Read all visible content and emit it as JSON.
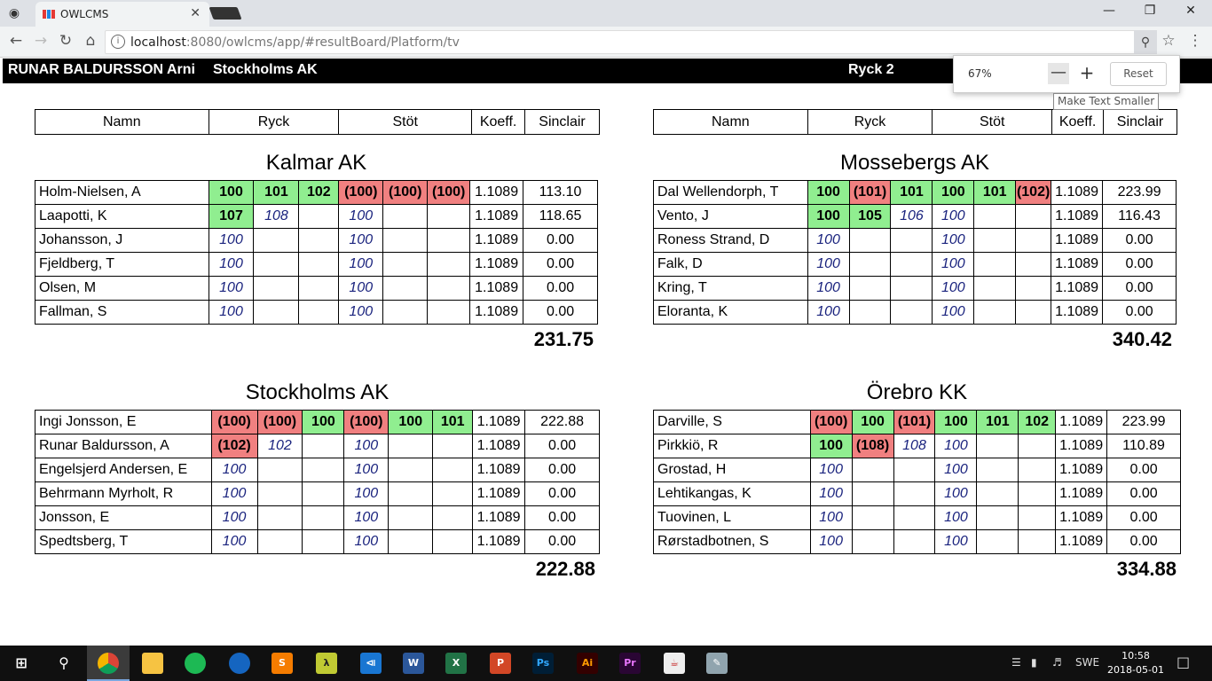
{
  "browser": {
    "tab_title": "OWLCMS",
    "url_host": "localhost",
    "url_rest": ":8080/owlcms/app/#resultBoard/Platform/tv",
    "zoom_percent": "67%",
    "zoom_reset_label": "Reset",
    "tooltip": "Make Text Smaller"
  },
  "header": {
    "athlete": "RUNAR BALDURSSON Arni",
    "team": "Stockholms AK",
    "lift": "Ryck 2"
  },
  "columns": {
    "name": "Namn",
    "snatch": "Ryck",
    "cj": "Stöt",
    "koeff": "Koeff.",
    "sinclair": "Sinclair"
  },
  "colors": {
    "good_lift": "#90ee90",
    "bad_lift": "#f08080",
    "requested": "#1a237e"
  },
  "teams": [
    {
      "name": "Kalmar AK",
      "total": "231.75",
      "athletes": [
        {
          "name": "Holm-Nielsen, A",
          "lifts": [
            [
              "100",
              "good"
            ],
            [
              "101",
              "good"
            ],
            [
              "102",
              "good"
            ],
            [
              "(100)",
              "bad"
            ],
            [
              "(100)",
              "bad"
            ],
            [
              "(100)",
              "bad"
            ]
          ],
          "koeff": "1.1089",
          "sinclair": "113.10"
        },
        {
          "name": "Laapotti, K",
          "lifts": [
            [
              "107",
              "good"
            ],
            [
              "108",
              "req"
            ],
            [
              "",
              ""
            ],
            [
              "100",
              "req"
            ],
            [
              "",
              ""
            ],
            [
              "",
              ""
            ]
          ],
          "koeff": "1.1089",
          "sinclair": "118.65"
        },
        {
          "name": "Johansson, J",
          "lifts": [
            [
              "100",
              "req"
            ],
            [
              "",
              ""
            ],
            [
              "",
              ""
            ],
            [
              "100",
              "req"
            ],
            [
              "",
              ""
            ],
            [
              "",
              ""
            ]
          ],
          "koeff": "1.1089",
          "sinclair": "0.00"
        },
        {
          "name": "Fjeldberg, T",
          "lifts": [
            [
              "100",
              "req"
            ],
            [
              "",
              ""
            ],
            [
              "",
              ""
            ],
            [
              "100",
              "req"
            ],
            [
              "",
              ""
            ],
            [
              "",
              ""
            ]
          ],
          "koeff": "1.1089",
          "sinclair": "0.00"
        },
        {
          "name": "Olsen, M",
          "lifts": [
            [
              "100",
              "req"
            ],
            [
              "",
              ""
            ],
            [
              "",
              ""
            ],
            [
              "100",
              "req"
            ],
            [
              "",
              ""
            ],
            [
              "",
              ""
            ]
          ],
          "koeff": "1.1089",
          "sinclair": "0.00"
        },
        {
          "name": "Fallman, S",
          "lifts": [
            [
              "100",
              "req"
            ],
            [
              "",
              ""
            ],
            [
              "",
              ""
            ],
            [
              "100",
              "req"
            ],
            [
              "",
              ""
            ],
            [
              "",
              ""
            ]
          ],
          "koeff": "1.1089",
          "sinclair": "0.00"
        }
      ]
    },
    {
      "name": "Mossebergs AK",
      "total": "340.42",
      "athletes": [
        {
          "name": "Dal Wellendorph, T",
          "lifts": [
            [
              "100",
              "good"
            ],
            [
              "(101)",
              "bad"
            ],
            [
              "101",
              "good"
            ],
            [
              "100",
              "good"
            ],
            [
              "101",
              "good"
            ],
            [
              "(102)",
              "bad"
            ]
          ],
          "koeff": "1.1089",
          "sinclair": "223.99"
        },
        {
          "name": "Vento, J",
          "lifts": [
            [
              "100",
              "good"
            ],
            [
              "105",
              "good"
            ],
            [
              "106",
              "req"
            ],
            [
              "100",
              "req"
            ],
            [
              "",
              ""
            ],
            [
              "",
              ""
            ]
          ],
          "koeff": "1.1089",
          "sinclair": "116.43"
        },
        {
          "name": "Roness Strand, D",
          "lifts": [
            [
              "100",
              "req"
            ],
            [
              "",
              ""
            ],
            [
              "",
              ""
            ],
            [
              "100",
              "req"
            ],
            [
              "",
              ""
            ],
            [
              "",
              ""
            ]
          ],
          "koeff": "1.1089",
          "sinclair": "0.00"
        },
        {
          "name": "Falk, D",
          "lifts": [
            [
              "100",
              "req"
            ],
            [
              "",
              ""
            ],
            [
              "",
              ""
            ],
            [
              "100",
              "req"
            ],
            [
              "",
              ""
            ],
            [
              "",
              ""
            ]
          ],
          "koeff": "1.1089",
          "sinclair": "0.00"
        },
        {
          "name": "Kring, T",
          "lifts": [
            [
              "100",
              "req"
            ],
            [
              "",
              ""
            ],
            [
              "",
              ""
            ],
            [
              "100",
              "req"
            ],
            [
              "",
              ""
            ],
            [
              "",
              ""
            ]
          ],
          "koeff": "1.1089",
          "sinclair": "0.00"
        },
        {
          "name": "Eloranta, K",
          "lifts": [
            [
              "100",
              "req"
            ],
            [
              "",
              ""
            ],
            [
              "",
              ""
            ],
            [
              "100",
              "req"
            ],
            [
              "",
              ""
            ],
            [
              "",
              ""
            ]
          ],
          "koeff": "1.1089",
          "sinclair": "0.00"
        }
      ]
    },
    {
      "name": "Stockholms AK",
      "total": "222.88",
      "athletes": [
        {
          "name": "Ingi Jonsson, E",
          "lifts": [
            [
              "(100)",
              "bad"
            ],
            [
              "(100)",
              "bad"
            ],
            [
              "100",
              "good"
            ],
            [
              "(100)",
              "bad"
            ],
            [
              "100",
              "good"
            ],
            [
              "101",
              "good"
            ]
          ],
          "koeff": "1.1089",
          "sinclair": "222.88"
        },
        {
          "name": "Runar Baldursson, A",
          "lifts": [
            [
              "(102)",
              "bad"
            ],
            [
              "102",
              "req"
            ],
            [
              "",
              ""
            ],
            [
              "100",
              "req"
            ],
            [
              "",
              ""
            ],
            [
              "",
              ""
            ]
          ],
          "koeff": "1.1089",
          "sinclair": "0.00"
        },
        {
          "name": "Engelsjerd Andersen, E",
          "lifts": [
            [
              "100",
              "req"
            ],
            [
              "",
              ""
            ],
            [
              "",
              ""
            ],
            [
              "100",
              "req"
            ],
            [
              "",
              ""
            ],
            [
              "",
              ""
            ]
          ],
          "koeff": "1.1089",
          "sinclair": "0.00"
        },
        {
          "name": "Behrmann Myrholt, R",
          "lifts": [
            [
              "100",
              "req"
            ],
            [
              "",
              ""
            ],
            [
              "",
              ""
            ],
            [
              "100",
              "req"
            ],
            [
              "",
              ""
            ],
            [
              "",
              ""
            ]
          ],
          "koeff": "1.1089",
          "sinclair": "0.00"
        },
        {
          "name": "Jonsson, E",
          "lifts": [
            [
              "100",
              "req"
            ],
            [
              "",
              ""
            ],
            [
              "",
              ""
            ],
            [
              "100",
              "req"
            ],
            [
              "",
              ""
            ],
            [
              "",
              ""
            ]
          ],
          "koeff": "1.1089",
          "sinclair": "0.00"
        },
        {
          "name": "Spedtsberg, T",
          "lifts": [
            [
              "100",
              "req"
            ],
            [
              "",
              ""
            ],
            [
              "",
              ""
            ],
            [
              "100",
              "req"
            ],
            [
              "",
              ""
            ],
            [
              "",
              ""
            ]
          ],
          "koeff": "1.1089",
          "sinclair": "0.00"
        }
      ]
    },
    {
      "name": "Örebro KK",
      "total": "334.88",
      "athletes": [
        {
          "name": "Darville, S",
          "lifts": [
            [
              "(100)",
              "bad"
            ],
            [
              "100",
              "good"
            ],
            [
              "(101)",
              "bad"
            ],
            [
              "100",
              "good"
            ],
            [
              "101",
              "good"
            ],
            [
              "102",
              "good"
            ]
          ],
          "koeff": "1.1089",
          "sinclair": "223.99"
        },
        {
          "name": "Pirkkiö, R",
          "lifts": [
            [
              "100",
              "good"
            ],
            [
              "(108)",
              "bad"
            ],
            [
              "108",
              "req"
            ],
            [
              "100",
              "req"
            ],
            [
              "",
              ""
            ],
            [
              "",
              ""
            ]
          ],
          "koeff": "1.1089",
          "sinclair": "110.89"
        },
        {
          "name": "Grostad, H",
          "lifts": [
            [
              "100",
              "req"
            ],
            [
              "",
              ""
            ],
            [
              "",
              ""
            ],
            [
              "100",
              "req"
            ],
            [
              "",
              ""
            ],
            [
              "",
              ""
            ]
          ],
          "koeff": "1.1089",
          "sinclair": "0.00"
        },
        {
          "name": "Lehtikangas, K",
          "lifts": [
            [
              "100",
              "req"
            ],
            [
              "",
              ""
            ],
            [
              "",
              ""
            ],
            [
              "100",
              "req"
            ],
            [
              "",
              ""
            ],
            [
              "",
              ""
            ]
          ],
          "koeff": "1.1089",
          "sinclair": "0.00"
        },
        {
          "name": "Tuovinen, L",
          "lifts": [
            [
              "100",
              "req"
            ],
            [
              "",
              ""
            ],
            [
              "",
              ""
            ],
            [
              "100",
              "req"
            ],
            [
              "",
              ""
            ],
            [
              "",
              ""
            ]
          ],
          "koeff": "1.1089",
          "sinclair": "0.00"
        },
        {
          "name": "Rørstadbotnen, S",
          "lifts": [
            [
              "100",
              "req"
            ],
            [
              "",
              ""
            ],
            [
              "",
              ""
            ],
            [
              "100",
              "req"
            ],
            [
              "",
              ""
            ],
            [
              "",
              ""
            ]
          ],
          "koeff": "1.1089",
          "sinclair": "0.00"
        }
      ]
    }
  ],
  "taskbar": {
    "language": "SWE",
    "time": "10:58",
    "date": "2018-05-01"
  }
}
